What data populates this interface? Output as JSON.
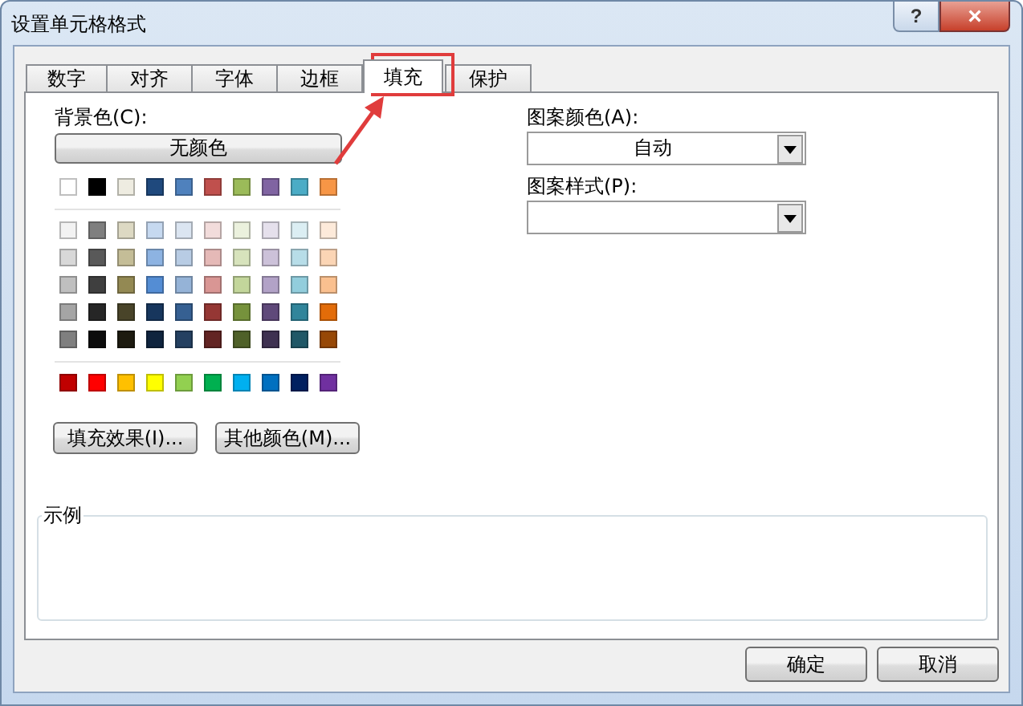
{
  "window": {
    "title": "设置单元格格式",
    "help_button": "?",
    "close_button": "×"
  },
  "tabs": [
    {
      "label": "数字",
      "selected": false
    },
    {
      "label": "对齐",
      "selected": false
    },
    {
      "label": "字体",
      "selected": false
    },
    {
      "label": "边框",
      "selected": false
    },
    {
      "label": "填充",
      "selected": true
    },
    {
      "label": "保护",
      "selected": false
    }
  ],
  "background_color": {
    "label": "背景色(C):",
    "no_color_button": "无颜色",
    "theme_row": [
      {
        "color": "#ffffff"
      },
      {
        "color": "#000000"
      },
      {
        "color": "#eeece1"
      },
      {
        "color": "#1f497d"
      },
      {
        "color": "#4f81bd"
      },
      {
        "color": "#c0504d"
      },
      {
        "color": "#9bbb59"
      },
      {
        "color": "#8064a2"
      },
      {
        "color": "#4bacc6"
      },
      {
        "color": "#f79646"
      }
    ],
    "tint_rows": [
      [
        {
          "color": "#f2f2f2"
        },
        {
          "color": "#7f7f7f"
        },
        {
          "color": "#ddd9c3"
        },
        {
          "color": "#c6d9f0"
        },
        {
          "color": "#dbe5f1"
        },
        {
          "color": "#f2dcdb"
        },
        {
          "color": "#ebf1dd"
        },
        {
          "color": "#e5e0ec"
        },
        {
          "color": "#dbeef3"
        },
        {
          "color": "#fdeada"
        }
      ],
      [
        {
          "color": "#d8d8d8"
        },
        {
          "color": "#595959"
        },
        {
          "color": "#c4bd97"
        },
        {
          "color": "#8db3e2"
        },
        {
          "color": "#b8cce4"
        },
        {
          "color": "#e5b9b7"
        },
        {
          "color": "#d7e3bc"
        },
        {
          "color": "#ccc1d9"
        },
        {
          "color": "#b7dde8"
        },
        {
          "color": "#fbd5b5"
        }
      ],
      [
        {
          "color": "#bfbfbf"
        },
        {
          "color": "#3f3f3f"
        },
        {
          "color": "#938953"
        },
        {
          "color": "#548dd4"
        },
        {
          "color": "#95b3d7"
        },
        {
          "color": "#d99694"
        },
        {
          "color": "#c3d69b"
        },
        {
          "color": "#b2a2c7"
        },
        {
          "color": "#92cddc"
        },
        {
          "color": "#fac08f"
        }
      ],
      [
        {
          "color": "#a5a5a5"
        },
        {
          "color": "#262626"
        },
        {
          "color": "#494429"
        },
        {
          "color": "#17365d"
        },
        {
          "color": "#366092"
        },
        {
          "color": "#953734"
        },
        {
          "color": "#76923c"
        },
        {
          "color": "#5f497a"
        },
        {
          "color": "#31859b"
        },
        {
          "color": "#e36c09"
        }
      ],
      [
        {
          "color": "#7f7f7f"
        },
        {
          "color": "#0c0c0c"
        },
        {
          "color": "#1d1b10"
        },
        {
          "color": "#0f243e"
        },
        {
          "color": "#244061"
        },
        {
          "color": "#632423"
        },
        {
          "color": "#4f6128"
        },
        {
          "color": "#3f3151"
        },
        {
          "color": "#205867"
        },
        {
          "color": "#974806"
        }
      ]
    ],
    "standard_row": [
      {
        "color": "#c00000"
      },
      {
        "color": "#ff0000"
      },
      {
        "color": "#ffc000"
      },
      {
        "color": "#ffff00"
      },
      {
        "color": "#92d050"
      },
      {
        "color": "#00b050"
      },
      {
        "color": "#00b0f0"
      },
      {
        "color": "#0070c0"
      },
      {
        "color": "#002060"
      },
      {
        "color": "#7030a0"
      }
    ],
    "buttons": [
      "填充效果(I)...",
      "其他颜色(M)..."
    ]
  },
  "pattern_color": {
    "label": "图案颜色(A):",
    "value": "自动"
  },
  "pattern_style": {
    "label": "图案样式(P):"
  },
  "sample": {
    "label": "示例"
  },
  "footer_buttons": [
    "确定",
    "取消"
  ]
}
